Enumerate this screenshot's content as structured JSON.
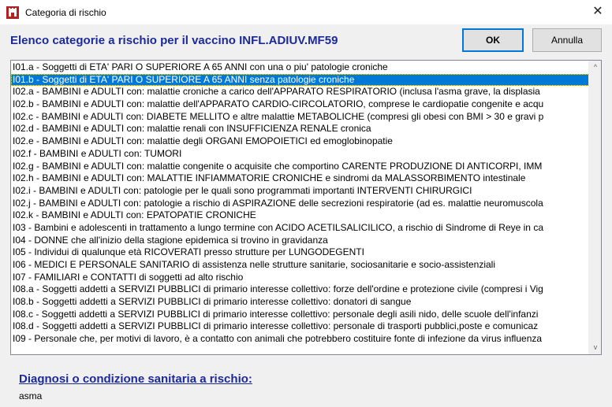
{
  "window": {
    "title": "Categoria di rischio",
    "icon": "castle-tower-icon",
    "close_symbol": "✕"
  },
  "header": {
    "title": "Elenco categorie a rischio per il vaccino INFL.ADIUV.MF59",
    "ok_label": "OK",
    "cancel_label": "Annulla"
  },
  "list": {
    "selected_index": 1,
    "items": [
      "I01.a  - Soggetti di ETA' PARI  O SUPERIORE A 65 ANNI con una o piu' patologie croniche",
      "I01.b  - Soggetti di ETA' PARI  O SUPERIORE A 65 ANNI senza patologie croniche",
      "I02.a - BAMBINI e ADULTI con: malattie croniche a carico dell'APPARATO RESPIRATORIO (inclusa l'asma grave, la displasia",
      "I02.b - BAMBINI e ADULTI con: malattie dell'APPARATO CARDIO-CIRCOLATORIO, comprese le cardiopatie congenite e acqu",
      "I02.c - BAMBINI e ADULTI con: DIABETE MELLITO e altre malattie METABOLICHE (compresi gli obesi con BMI > 30 e gravi p",
      "I02.d - BAMBINI e ADULTI con: malattie renali con INSUFFICIENZA RENALE cronica",
      "I02.e - BAMBINI e ADULTI con: malattie degli ORGANI EMOPOIETICI ed emoglobinopatie",
      "I02.f - BAMBINI e ADULTI con: TUMORI",
      "I02.g - BAMBINI e ADULTI con: malattie congenite o acquisite che comportino CARENTE PRODUZIONE DI ANTICORPI, IMM",
      "I02.h - BAMBINI e ADULTI con: MALATTIE INFIAMMATORIE CRONICHE e sindromi da MALASSORBIMENTO intestinale",
      "I02.i - BAMBINI e ADULTI con: patologie per le quali sono programmati importanti INTERVENTI CHIRURGICI",
      "I02.j - BAMBINI e ADULTI con: patologie a rischio di ASPIRAZIONE delle secrezioni respiratorie (ad es. malattie neuromuscola",
      "I02.k - BAMBINI e ADULTI con: EPATOPATIE CRONICHE",
      "I03 - Bambini e adolescenti in trattamento a lungo termine con ACIDO ACETILSALICILICO, a rischio di Sindrome di Reye in ca",
      "I04 - DONNE che all'inizio della stagione epidemica si trovino in gravidanza",
      "I05 - Individui di qualunque età RICOVERATI presso strutture per LUNGODEGENTI",
      "I06 - MEDICI E PERSONALE SANITARIO di assistenza nelle strutture sanitarie, sociosanitarie e socio-assistenziali",
      "I07 - FAMILIARI e CONTATTI di soggetti ad alto rischio",
      "I08.a - Soggetti addetti a SERVIZI PUBBLICI di primario interesse collettivo: forze dell'ordine e protezione civile (compresi i Vig",
      "I08.b - Soggetti addetti a SERVIZI PUBBLICI di primario interesse collettivo: donatori di sangue",
      "I08.c - Soggetti addetti a SERVIZI PUBBLICI di primario interesse collettivo: personale degli asili nido, delle scuole dell'infanzi",
      "I08.d - Soggetti addetti a SERVIZI PUBBLICI di primario interesse collettivo: personale di trasporti pubblici,poste e comunicaz",
      "I09 - Personale che, per motivi di lavoro, è a contatto con animali che potrebbero costituire fonte di infezione da virus influenza"
    ]
  },
  "scrollbar": {
    "up_symbol": "^",
    "down_symbol": "v"
  },
  "diagnosis": {
    "label": "Diagnosi o condizione sanitaria a rischio:",
    "value": "asma"
  }
}
